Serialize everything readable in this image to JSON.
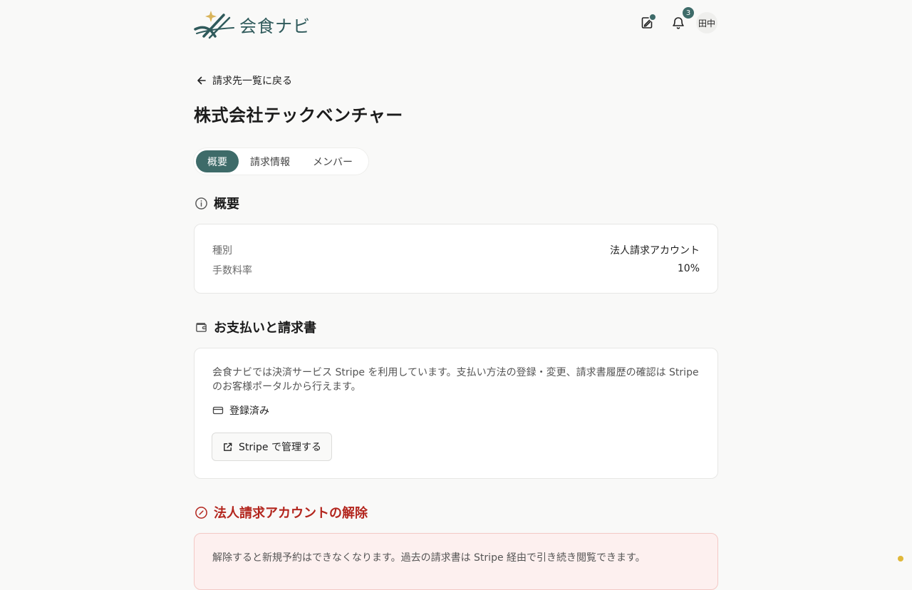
{
  "header": {
    "logo_text": "会食ナビ",
    "notification_count": "3",
    "user_initials": "田中",
    "icons": [
      "edit-icon",
      "bell-icon"
    ]
  },
  "back_link": {
    "label": "請求先一覧に戻る"
  },
  "page_title": "株式会社テックベンチャー",
  "tabs": [
    {
      "label": "概要",
      "active": true
    },
    {
      "label": "請求情報",
      "active": false
    },
    {
      "label": "メンバー",
      "active": false
    }
  ],
  "overview": {
    "heading": "概要",
    "rows": [
      {
        "key": "種別",
        "value": "法人請求アカウント"
      },
      {
        "key": "手数料率",
        "value": "10%"
      }
    ]
  },
  "payments": {
    "heading": "お支払いと請求書",
    "description_line1": "会食ナビでは決済サービス Stripe を利用しています。支払い方法の登録・変更、請求書履歴の確認は Stripe",
    "description_line2": "のお客様ポータルから行えます。",
    "status": "登録済み",
    "manage_button": "Stripe で管理する"
  },
  "cancel": {
    "heading": "法人請求アカウントの解除",
    "description": "解除すると新規予約はできなくなります。過去の請求書は Stripe 経由で引き続き閲覧できます。"
  },
  "colors": {
    "primary": "#3e6b69",
    "danger": "#b3261e",
    "danger_bg": "#fdf0ef",
    "background": "#f9f9f8"
  }
}
